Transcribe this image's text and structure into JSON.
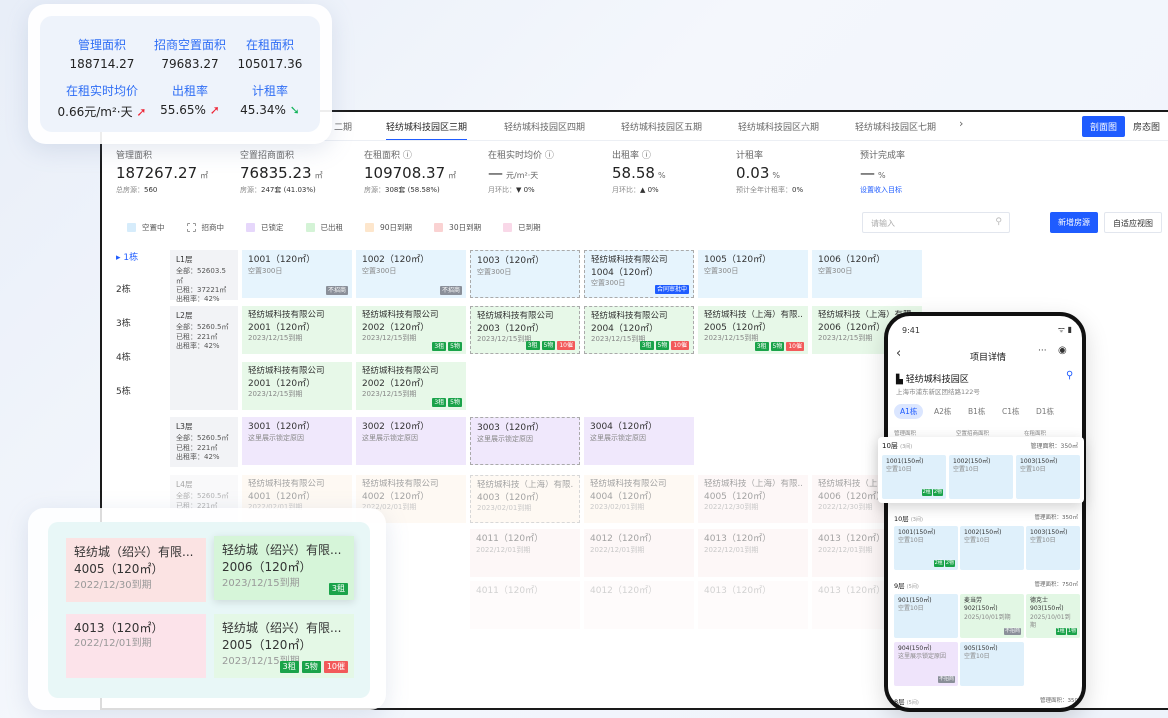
{
  "kpi_card": {
    "items": [
      {
        "label": "管理面积",
        "value": "188714.27"
      },
      {
        "label": "招商空置面积",
        "value": "79683.27"
      },
      {
        "label": "在租面积",
        "value": "105017.36"
      },
      {
        "label": "在租实时均价",
        "value": "0.66元/m²·天",
        "trend": "up"
      },
      {
        "label": "出租率",
        "value": "55.65%",
        "trend": "up"
      },
      {
        "label": "计租率",
        "value": "45.34%",
        "trend": "down"
      }
    ]
  },
  "tabs": {
    "items": [
      "二期",
      "轻纺城科技园区三期",
      "轻纺城科技园区四期",
      "轻纺城科技园区五期",
      "轻纺城科技园区六期",
      "轻纺城科技园区七期"
    ],
    "more": "›",
    "view_section": "剖面图",
    "view_state": "房态图"
  },
  "stats": [
    {
      "label": "管理面积",
      "value": "187267.27",
      "unit": "㎡",
      "sub": "总房源：",
      "sub_val": "560"
    },
    {
      "label": "空置招商面积",
      "value": "76835.23",
      "unit": "㎡",
      "sub": "房源：",
      "sub_val": "247套 (41.03%)"
    },
    {
      "label": "在租面积 ⓘ",
      "value": "109708.37",
      "unit": "㎡",
      "sub": "房源：",
      "sub_val": "308套 (58.58%)"
    },
    {
      "label": "在租实时均价 ⓘ",
      "value": "—",
      "unit": "元/m²·天",
      "sub": "月环比：",
      "sub_val": "▼ 0%",
      "sub_dir": "down"
    },
    {
      "label": "出租率 ⓘ",
      "value": "58.58",
      "unit": "%",
      "sub": "月环比：",
      "sub_val": "▲ 0%",
      "sub_dir": "up"
    },
    {
      "label": "计租率",
      "value": "0.03",
      "unit": "%",
      "sub": "预计全年计租率：",
      "sub_val": "0%"
    },
    {
      "label": "预计完成率",
      "value": "—",
      "unit": "%",
      "link": "设置收入目标"
    }
  ],
  "legend": [
    {
      "label": "空置中",
      "color": "#d6ecfb"
    },
    {
      "label": "招商中",
      "color": "#ffffff",
      "dashed": true
    },
    {
      "label": "已锁定",
      "color": "#e6d7fb"
    },
    {
      "label": "已出租",
      "color": "#d4f3d6"
    },
    {
      "label": "90日到期",
      "color": "#fde6cc"
    },
    {
      "label": "30日到期",
      "color": "#fad2d2"
    },
    {
      "label": "已到期",
      "color": "#f9d8e8"
    }
  ],
  "search": {
    "placeholder": "请输入",
    "icon": "search-icon"
  },
  "buttons": {
    "add": "新增房源",
    "adaptive": "自适应视图"
  },
  "buildings": [
    "▸ 1栋",
    "2栋",
    "3栋",
    "4栋",
    "5栋"
  ],
  "floors": [
    {
      "name": "L1层",
      "l1": "全部：52603.5㎡",
      "l2": "已租：37221㎡",
      "l3": "出租率：42%"
    },
    {
      "name": "L2层",
      "l1": "全部：5260.5㎡",
      "l2": "已租：221㎡",
      "l3": "出租率：42%"
    },
    {
      "name": "L3层",
      "l1": "全部：5260.5㎡",
      "l2": "已租：221㎡",
      "l3": "出租率：42%"
    },
    {
      "name": "L4层",
      "l1": "全部：5260.5㎡",
      "l2": "已租：221㎡",
      "l3": ""
    }
  ],
  "units": {
    "r1": [
      {
        "unit": "1001（120㎡）",
        "desc": "空置300日",
        "badge": "不招商"
      },
      {
        "unit": "1002（120㎡）",
        "desc": "空置300日",
        "badge": "不招商"
      },
      {
        "unit": "1003（120㎡）",
        "desc": "空置300日"
      },
      {
        "company": "轻纺城科技有限公司",
        "unit": "1004（120㎡）",
        "desc": "空置300日",
        "badge": "合同审批中"
      },
      {
        "unit": "1005（120㎡）",
        "desc": "空置300日"
      },
      {
        "unit": "1006（120㎡）",
        "desc": "空置300日"
      }
    ],
    "r2": [
      {
        "company": "轻纺城科技有限公司",
        "unit": "2001（120㎡）",
        "desc": "2023/12/15到期"
      },
      {
        "company": "轻纺城科技有限公司",
        "unit": "2002（120㎡）",
        "desc": "2023/12/15到期",
        "b1": "3租",
        "b2": "5物"
      },
      {
        "company": "轻纺城科技有限公司",
        "unit": "2003（120㎡）",
        "desc": "2023/12/15到期",
        "b1": "3租",
        "b2": "5物",
        "b3": "10催"
      },
      {
        "company": "轻纺城科技有限公司",
        "unit": "2004（120㎡）",
        "desc": "2023/12/15到期",
        "b1": "3租",
        "b2": "5物",
        "b3": "10催"
      },
      {
        "company": "轻纺城科技（上海）有限...",
        "unit": "2005（120㎡）",
        "desc": "2023/12/15到期",
        "b1": "3租",
        "b2": "5物",
        "b3": "10催"
      },
      {
        "company": "轻纺城科技（上海）有限...",
        "unit": "2006（120㎡）",
        "desc": "2023/12/15到期"
      }
    ],
    "r3": [
      {
        "company": "轻纺城科技有限公司",
        "unit": "2001（120㎡）",
        "desc": "2023/12/15到期"
      },
      {
        "company": "轻纺城科技有限公司",
        "unit": "2002（120㎡）",
        "desc": "2023/12/15到期",
        "b1": "3租",
        "b2": "5物"
      }
    ],
    "r4": [
      {
        "unit": "3001（120㎡）",
        "desc": "这里展示锁定原因"
      },
      {
        "unit": "3002（120㎡）",
        "desc": "这里展示锁定原因"
      },
      {
        "unit": "3003（120㎡）",
        "desc": "这里展示锁定原因"
      },
      {
        "unit": "3004（120㎡）",
        "desc": "这里展示锁定原因"
      }
    ],
    "r5": [
      {
        "company": "轻纺城科技有限公司",
        "unit": "4001（120㎡）",
        "desc": "2022/02/01到期"
      },
      {
        "company": "轻纺城科技有限公司",
        "unit": "4002（120㎡）",
        "desc": "2022/02/01到期"
      },
      {
        "company": "轻纺城科技（上海）有限...",
        "unit": "4003（120㎡）",
        "desc": "2023/02/01到期"
      },
      {
        "company": "轻纺城科技有限公司",
        "unit": "4004（120㎡）",
        "desc": "2023/02/01到期"
      },
      {
        "company": "轻纺城科技（上海）有限...",
        "unit": "4005（120㎡）",
        "desc": "2022/12/30到期"
      },
      {
        "company": "轻纺城科技（上海）有限...",
        "unit": "4006（120㎡）",
        "desc": "2022/12/30到期"
      }
    ],
    "r6": [
      {
        "unit": "4011（120㎡）",
        "desc": "2022/12/01到期"
      },
      {
        "unit": "4012（120㎡）",
        "desc": "2022/12/01到期"
      },
      {
        "unit": "4013（120㎡）",
        "desc": "2022/12/01到期"
      },
      {
        "unit": "4013（120㎡）",
        "desc": "2022/12/01到期"
      }
    ],
    "r7": [
      {
        "unit": "4011（120㎡）"
      },
      {
        "unit": "4012（120㎡）"
      },
      {
        "unit": "4013（120㎡）"
      },
      {
        "unit": "4013（120㎡）"
      }
    ]
  },
  "zoom_card": [
    {
      "company": "轻纺城（绍兴）有限...",
      "unit": "4005（120㎡）",
      "desc": "2022/12/30到期"
    },
    {
      "company": "轻纺城（绍兴）有限...",
      "unit": "2006（120㎡）",
      "desc": "2023/12/15到期",
      "b1": "3租"
    },
    {
      "unit": "4013（120㎡）",
      "desc": "2022/12/01到期"
    },
    {
      "company": "轻纺城（绍兴）有限...",
      "unit": "2005（120㎡）",
      "desc": "2023/12/15到期",
      "b1": "3租",
      "b2": "5物",
      "b3": "10催"
    }
  ],
  "phone": {
    "time": "9:41",
    "title": "项目详情",
    "back": "‹",
    "more": "···",
    "park": "轻纺城科技园区",
    "address": "上海市浦东新区团结路122号",
    "chips": [
      "A1栋",
      "A2栋",
      "B1栋",
      "C1栋",
      "D1栋"
    ],
    "cols": [
      "管理面积",
      "空置招商面积",
      "在租面积"
    ],
    "f10": {
      "name": "10层",
      "rooms": "(3间)",
      "area": "管理面积：350㎡",
      "units": [
        {
          "unit": "1001(150㎡)",
          "desc": "空置10日",
          "b1": "2租",
          "b2": "2物"
        },
        {
          "unit": "1002(150㎡)",
          "desc": "空置10日"
        },
        {
          "unit": "1003(150㎡)",
          "desc": "空置10日"
        }
      ]
    },
    "f9": {
      "name": "9层",
      "rooms": "(5间)",
      "area": "管理面积：750㎡",
      "units": [
        {
          "unit": "901(150㎡)",
          "desc": "空置10日"
        },
        {
          "company": "麦当劳",
          "unit": "902(150㎡)",
          "desc": "2025/10/01到期",
          "b1": "不招商"
        },
        {
          "company": "德克士",
          "unit": "903(150㎡)",
          "desc": "2025/10/01到期",
          "b1": "1租",
          "b2": "1物"
        },
        {
          "unit": "904(150㎡)",
          "desc": "这里展示锁定原因",
          "b1": "不招商"
        },
        {
          "unit": "905(150㎡)",
          "desc": "空置10日"
        }
      ]
    },
    "f8": {
      "name": "8层",
      "rooms": "(5间)",
      "area": "管理面积：350"
    }
  },
  "colors": {
    "accent": "#1f5cff",
    "kpi_label": "#2f6ef5",
    "up": "#e23344",
    "down": "#12b35a"
  }
}
